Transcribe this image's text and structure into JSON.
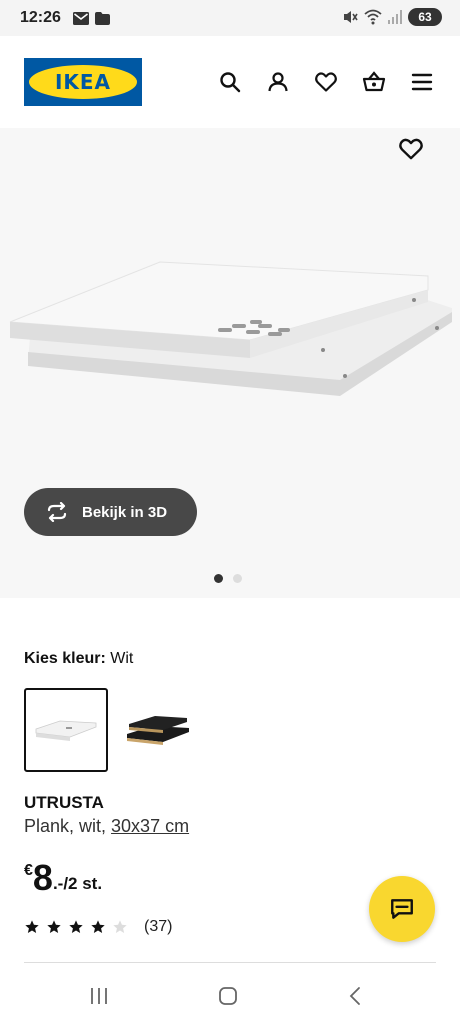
{
  "status_bar": {
    "time": "12:26",
    "battery": "63",
    "icons": [
      "mail-icon",
      "folder-icon",
      "mute-icon",
      "wifi-icon",
      "signal-icon",
      "battery-icon"
    ]
  },
  "header": {
    "logo_text": "IKEA",
    "icons": [
      "search-icon",
      "account-icon",
      "heart-icon",
      "basket-icon",
      "menu-icon"
    ]
  },
  "gallery": {
    "view_3d_label": "Bekijk in 3D",
    "image_count": 2,
    "active_index": 0
  },
  "color": {
    "label": "Kies kleur:",
    "value": "Wit",
    "options": [
      "white",
      "black"
    ]
  },
  "product": {
    "name": "UTRUSTA",
    "description": "Plank, wit, ",
    "size_link": "30x37 cm",
    "price_currency": "€",
    "price_amount": "8",
    "price_unit": ".-/2 st.",
    "rating_stars": 4,
    "rating_max": 5,
    "review_count": "(37)"
  },
  "colors": {
    "ikea_blue": "#0058a3",
    "ikea_yellow": "#ffda1a",
    "chat_yellow": "#f9d72f",
    "view3d_bg": "#484848"
  }
}
